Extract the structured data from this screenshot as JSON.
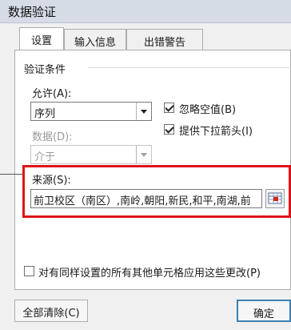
{
  "window": {
    "title": "数据验证"
  },
  "tabs": [
    {
      "label": "设置",
      "active": true
    },
    {
      "label": "输入信息",
      "active": false
    },
    {
      "label": "出错警告",
      "active": false
    }
  ],
  "validation_criteria": {
    "group_title": "验证条件",
    "allow_label": "允许(A):",
    "allow_value": "序列",
    "data_label": "数据(D):",
    "data_value": "介于",
    "ignore_blank_label": "忽略空值(B)",
    "ignore_blank_checked": true,
    "dropdown_label": "提供下拉箭头(I)",
    "dropdown_checked": true
  },
  "source": {
    "label": "来源(S):",
    "value": "前卫校区（南区）,南岭,朝阳,新民,和平,南湖,前"
  },
  "apply_all": {
    "label": "对有同样设置的所有其他单元格应用这些更改(P)",
    "checked": false
  },
  "buttons": {
    "clear_all": "全部清除(C)",
    "ok": "确定"
  },
  "colors": {
    "highlight": "#e0131a",
    "focus_border": "#3c7fb1"
  }
}
